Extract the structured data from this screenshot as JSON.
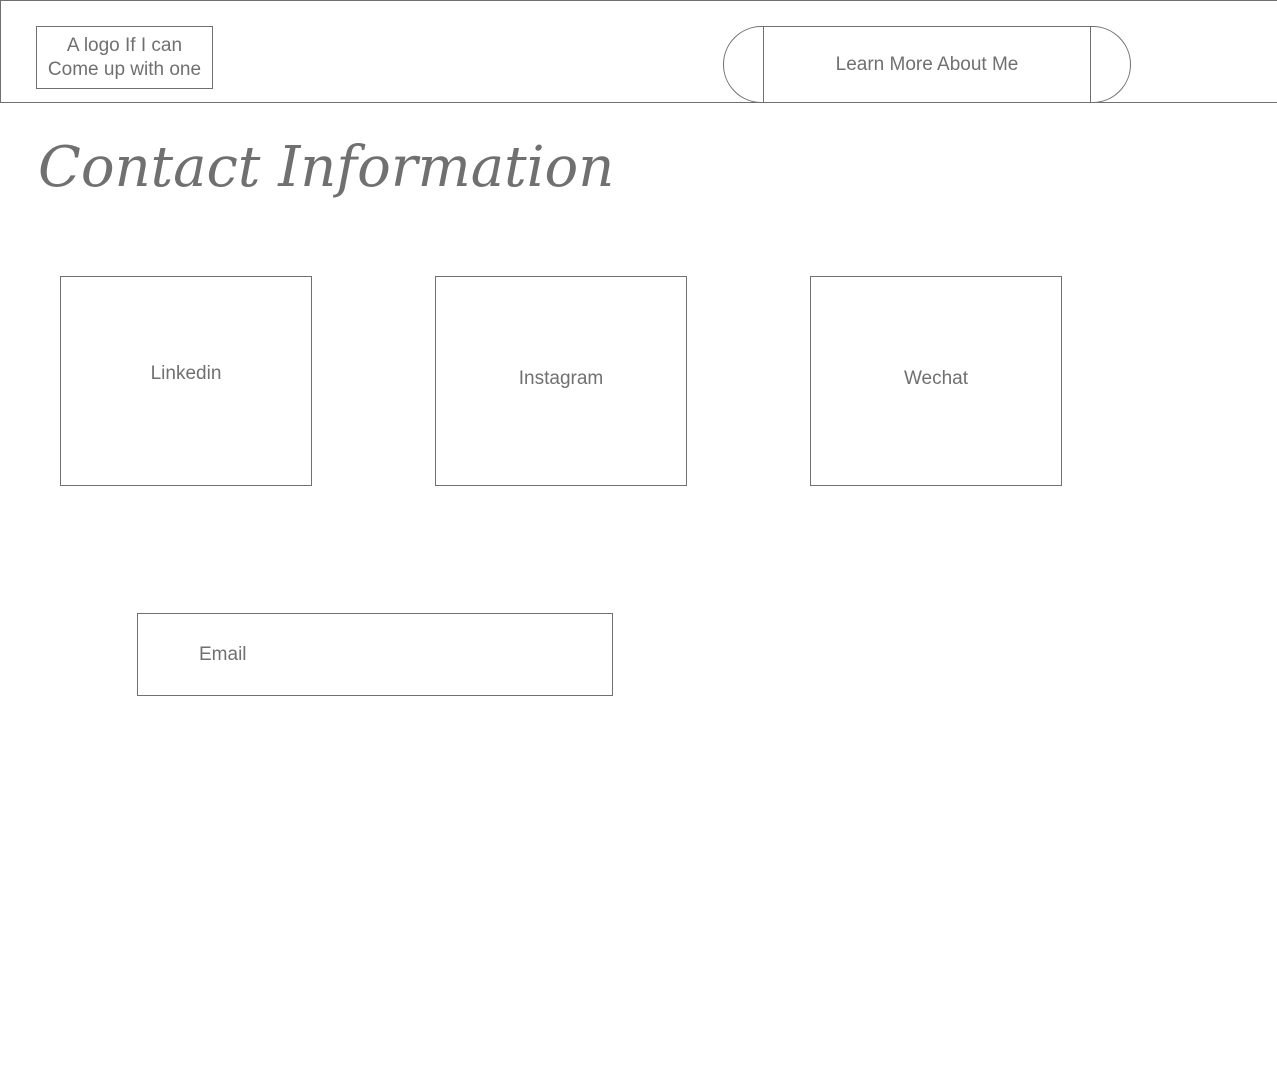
{
  "header": {
    "logo_line1": "A logo If I can",
    "logo_line2": "Come up with one",
    "nav_button_label": "Learn More About Me"
  },
  "main": {
    "title": "Contact Information",
    "contacts": [
      {
        "label": "Linkedin"
      },
      {
        "label": "Instagram"
      },
      {
        "label": "Wechat"
      }
    ],
    "email_label": "Email"
  },
  "colors": {
    "stroke": "#707070",
    "text": "#707070",
    "background": "#ffffff"
  }
}
